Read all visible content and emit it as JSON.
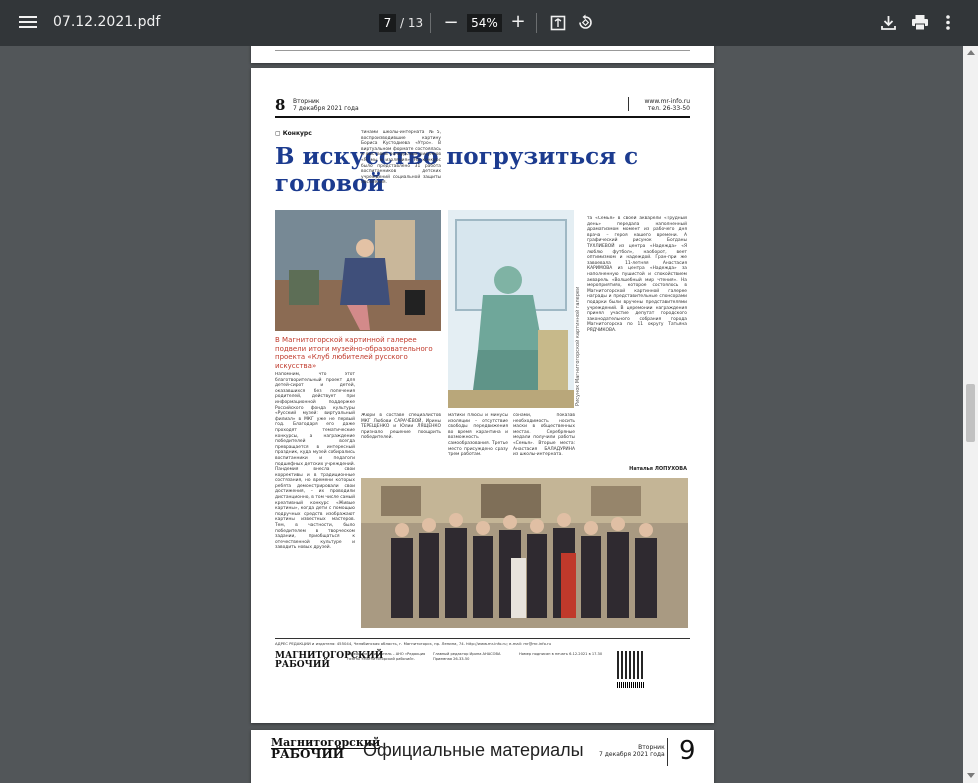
{
  "toolbar": {
    "title": "07.12.2021.pdf",
    "current_page": "7",
    "total_pages": "/ 13",
    "zoom": "54%",
    "zoom_minus": "−",
    "zoom_plus": "+",
    "icons": {
      "menu": "menu-icon",
      "fit": "fit-page-icon",
      "rotate": "rotate-icon",
      "download": "download-icon",
      "print": "print-icon",
      "more": "more-vert-icon"
    }
  },
  "page": {
    "header": {
      "number": "8",
      "day": "Вторник",
      "date": "7 декабря 2021 года",
      "site": "www.mr-info.ru",
      "phone": "тел. 26-33-50"
    },
    "section": "Конкурс",
    "headline": "В искусство погрузиться с головой",
    "caption": "В Магнитогорской картинной галерее подвели итоги музейно-образовательного проекта «Клуб любителей русского искусства»",
    "vertical_caption": "Рисунок Магнитогорской картинной галереи",
    "col1": "Напомним, что этот благотворительный проект для детей-сирот и детей, оказавшихся без попечения родителей, действует при информационной поддержке Российского фонда культуры «Русский музей: виртуальный филиал» в МКГ уже не первый год. Благодаря его даже проходят тематические конкурсы, а награждение победителей всегда превращается в интересный праздник, куда музей собирались воспитанники и педагоги подшефных детских учреждений. Пандемия внесла свои коррективы и в традиционные состязания, но времени которых ребята демонстрировали свои достижения, – их проводили дистанционно, в том числе самый креативный конкурс «Живые картины», когда дети с помощью подручных средств изображают картины известных мастеров. Тем, в частности, было победителем в творческом задании, приобщаться к отечественной культуре и заводить новых друзей.",
    "col2": "тинами школы-интерната №5, воспроизводившие картину Бориса Кустодиева «Утро». В виртуальном формате состоялась и выставка конкурсных рисунков «Я, мы и изоляция». На конкурс было представлено 31 работа воспитанников детских учреждений социальной защиты населения.",
    "col2b": "Жюри в составе специалистов МКГ Любови САРАЧЁВОЙ, Ирины ТЕРЕЩЕНКО и Юлии ЛЯЩЕНКО признало решение поощрить победителей.",
    "col3": "матики плюсы и минусы изоляции – отсутствие свободы передвижения во время карантина и возможность самообразования. Третье место присуждено сразу трем работам.",
    "col4": "сонами, показав необходимость носить маски в общественных местах. Серебряные медали получили работы «Семья». Вторые места: Анастасия БАЛАДУРИНА из школы-интерната.",
    "col5": "та «Семья» в своей акварели «Трудный день» передала наполненный драматизмом момент из рабочего дня врача – героя нашего времени. А графический рисунок Богданы ТУХЛИЕВОЙ из центра «Надежда» «Я люблю футбол», наоборот, веет оптимизмом и надеждой. Гран-при же завоевала 11-летняя Анастасия КАРИМОВА из центра «Надежда» за наполненную пушистой и спокойствием акварель «Волшебный мир чтения». На мероприятиях, которое состоялось в Магнитогорской картинной галерее награды и представительные спонсорами подарки были вручены представителями учреждений. В церемонии награждения принял участие депутат городского законодательного собрания города Магнитогорска по 11 округу Татьяна РЯДЧИКОВА.",
    "author": "Наталья ЛОПУХОВА",
    "footer": "АДРЕС РЕДАКЦИИ и издателя: 455044, Челябинская область, г. Магнитогорск, пр. Ленина, 74. http://www.mr-info.ru; e-mail: mr@mr-info.ru",
    "logo": "МАГНИТОГОРСКИЙ РАБОЧИЙ",
    "foot_editor": "Главный редактор Ирина АНАСОВА Приемная 26-33-50",
    "foot_print": "Номер подписан в печать 6.12.2021 в 17.30"
  },
  "next_page": {
    "logo_line1": "Магнитогорский",
    "logo_line2": "РАБОЧИЙ",
    "title": "Официальные материалы",
    "day": "Вторник",
    "date": "7 декабря 2021 года",
    "number": "9"
  }
}
